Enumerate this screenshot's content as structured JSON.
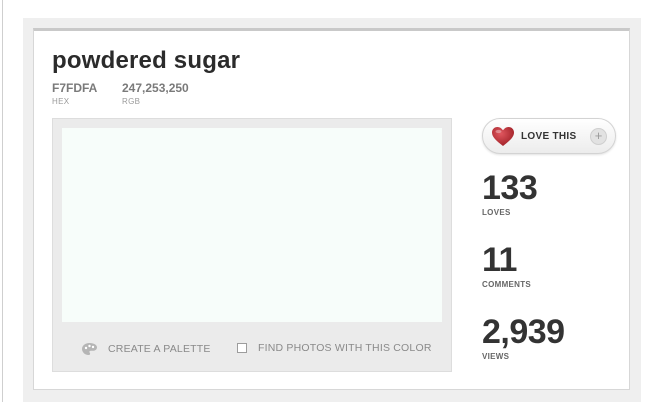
{
  "color": {
    "name": "powdered sugar",
    "hex": "F7FDFA",
    "hex_label": "HEX",
    "rgb": "247,253,250",
    "rgb_label": "RGB",
    "swatch_color": "#F7FDFA"
  },
  "actions": {
    "create_palette": "CREATE A PALETTE",
    "find_photos": "FIND PHOTOS WITH THIS COLOR"
  },
  "love_button": {
    "label": "LOVE THIS",
    "plus": "+"
  },
  "stats": {
    "loves": {
      "value": "133",
      "label": "LOVES"
    },
    "comments": {
      "value": "11",
      "label": "COMMENTS"
    },
    "views": {
      "value": "2,939",
      "label": "VIEWS"
    }
  }
}
